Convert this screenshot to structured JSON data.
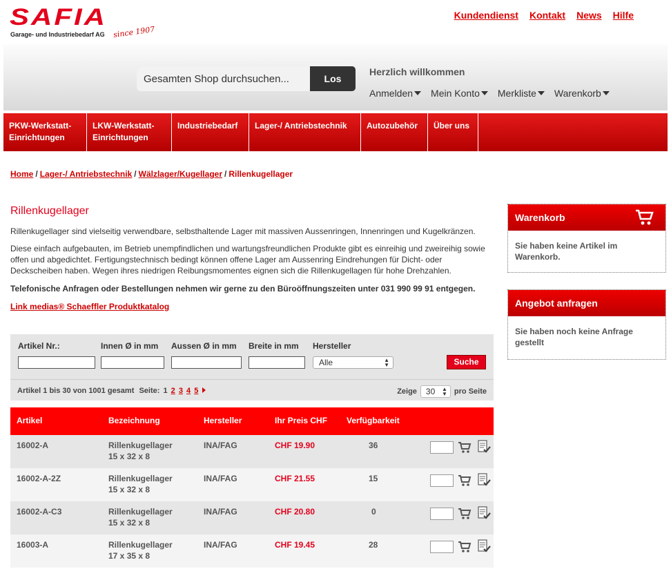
{
  "brand": {
    "logo": "SAFIA",
    "tagline": "Garage- und Industriebedarf AG",
    "since": "since 1907",
    "accent": "#e3001b"
  },
  "toplinks": [
    "Kundendienst",
    "Kontakt",
    "News",
    "Hilfe"
  ],
  "search": {
    "placeholder": "Gesamten Shop durchsuchen...",
    "button": "Los"
  },
  "account": {
    "welcome": "Herzlich willkommen",
    "menu": [
      "Anmelden",
      "Mein Konto",
      "Merkliste",
      "Warenkorb"
    ]
  },
  "nav": [
    "PKW-Werkstatt-\nEinrichtungen",
    "LKW-Werkstatt-\nEinrichtungen",
    "Industriebedarf",
    "Lager-/ Antriebstechnik",
    "Autozubehör",
    "Über uns"
  ],
  "breadcrumb": {
    "items": [
      "Home",
      "Lager-/ Antriebstechnik",
      "Wälzlager/Kugellager"
    ],
    "current": "Rillenkugellager",
    "sep": "/"
  },
  "content": {
    "title": "Rillenkugellager",
    "intro1": "Rillenkugellager sind vielseitig verwendbare, selbsthaltende Lager mit massiven Aussenringen, Innenringen und Kugelkränzen.",
    "intro2": "Diese einfach aufgebauten, im Betrieb unempfindlichen und wartungsfreundlichen Produkte gibt es einreihig und zweireihig sowie offen und abgedichtet. Fertigungstechnisch bedingt können offene Lager am Aussenring Eindrehungen für Dicht- oder Deckscheiben haben. Wegen ihres niedrigen Reibungsmomentes eignen sich die Rillenkugellagen für hohe Drehzahlen.",
    "phone": "Telefonische Anfragen oder Bestellungen nehmen wir gerne zu den Büroöffnungszeiten unter 031 990 99 91 entgegen.",
    "catalog_link": "Link medias® Schaeffler Produktkatalog"
  },
  "filter": {
    "labels": [
      "Artikel Nr.:",
      "Innen Ø in mm",
      "Aussen Ø in mm",
      "Breite in mm",
      "Hersteller"
    ],
    "manufacturer_selected": "Alle",
    "submit": "Suche"
  },
  "paging": {
    "summary": "Artikel 1 bis 30 von 1001 gesamt",
    "label": "Seite:",
    "pages": [
      "1",
      "2",
      "3",
      "4",
      "5"
    ],
    "current": "1",
    "show_label": "Zeige",
    "per_page": "30",
    "per_page_suffix": "pro Seite"
  },
  "table": {
    "headers": [
      "Artikel",
      "Bezeichnung",
      "Hersteller",
      "Ihr Preis CHF",
      "Verfügbarkeit"
    ],
    "rows": [
      {
        "article": "16002-A",
        "name": "Rillenkugellager",
        "dims": "15 x 32 x 8",
        "maker": "INA/FAG",
        "price": "CHF  19.90",
        "stock": "36"
      },
      {
        "article": "16002-A-2Z",
        "name": "Rillenkugellager",
        "dims": "15 x 32 x 8",
        "maker": "INA/FAG",
        "price": "CHF  21.55",
        "stock": "15"
      },
      {
        "article": "16002-A-C3",
        "name": "Rillenkugellager",
        "dims": "15 x 32 x 8",
        "maker": "INA/FAG",
        "price": "CHF  20.80",
        "stock": "0"
      },
      {
        "article": "16003-A",
        "name": "Rillenkugellager",
        "dims": "17 x 35 x 8",
        "maker": "INA/FAG",
        "price": "CHF  19.45",
        "stock": "28"
      }
    ]
  },
  "sidebar": {
    "cart": {
      "title": "Warenkorb",
      "text": "Sie haben keine Artikel im Warenkorb."
    },
    "quote": {
      "title": "Angebot anfragen",
      "text": "Sie haben noch keine Anfrage gestellt"
    }
  }
}
